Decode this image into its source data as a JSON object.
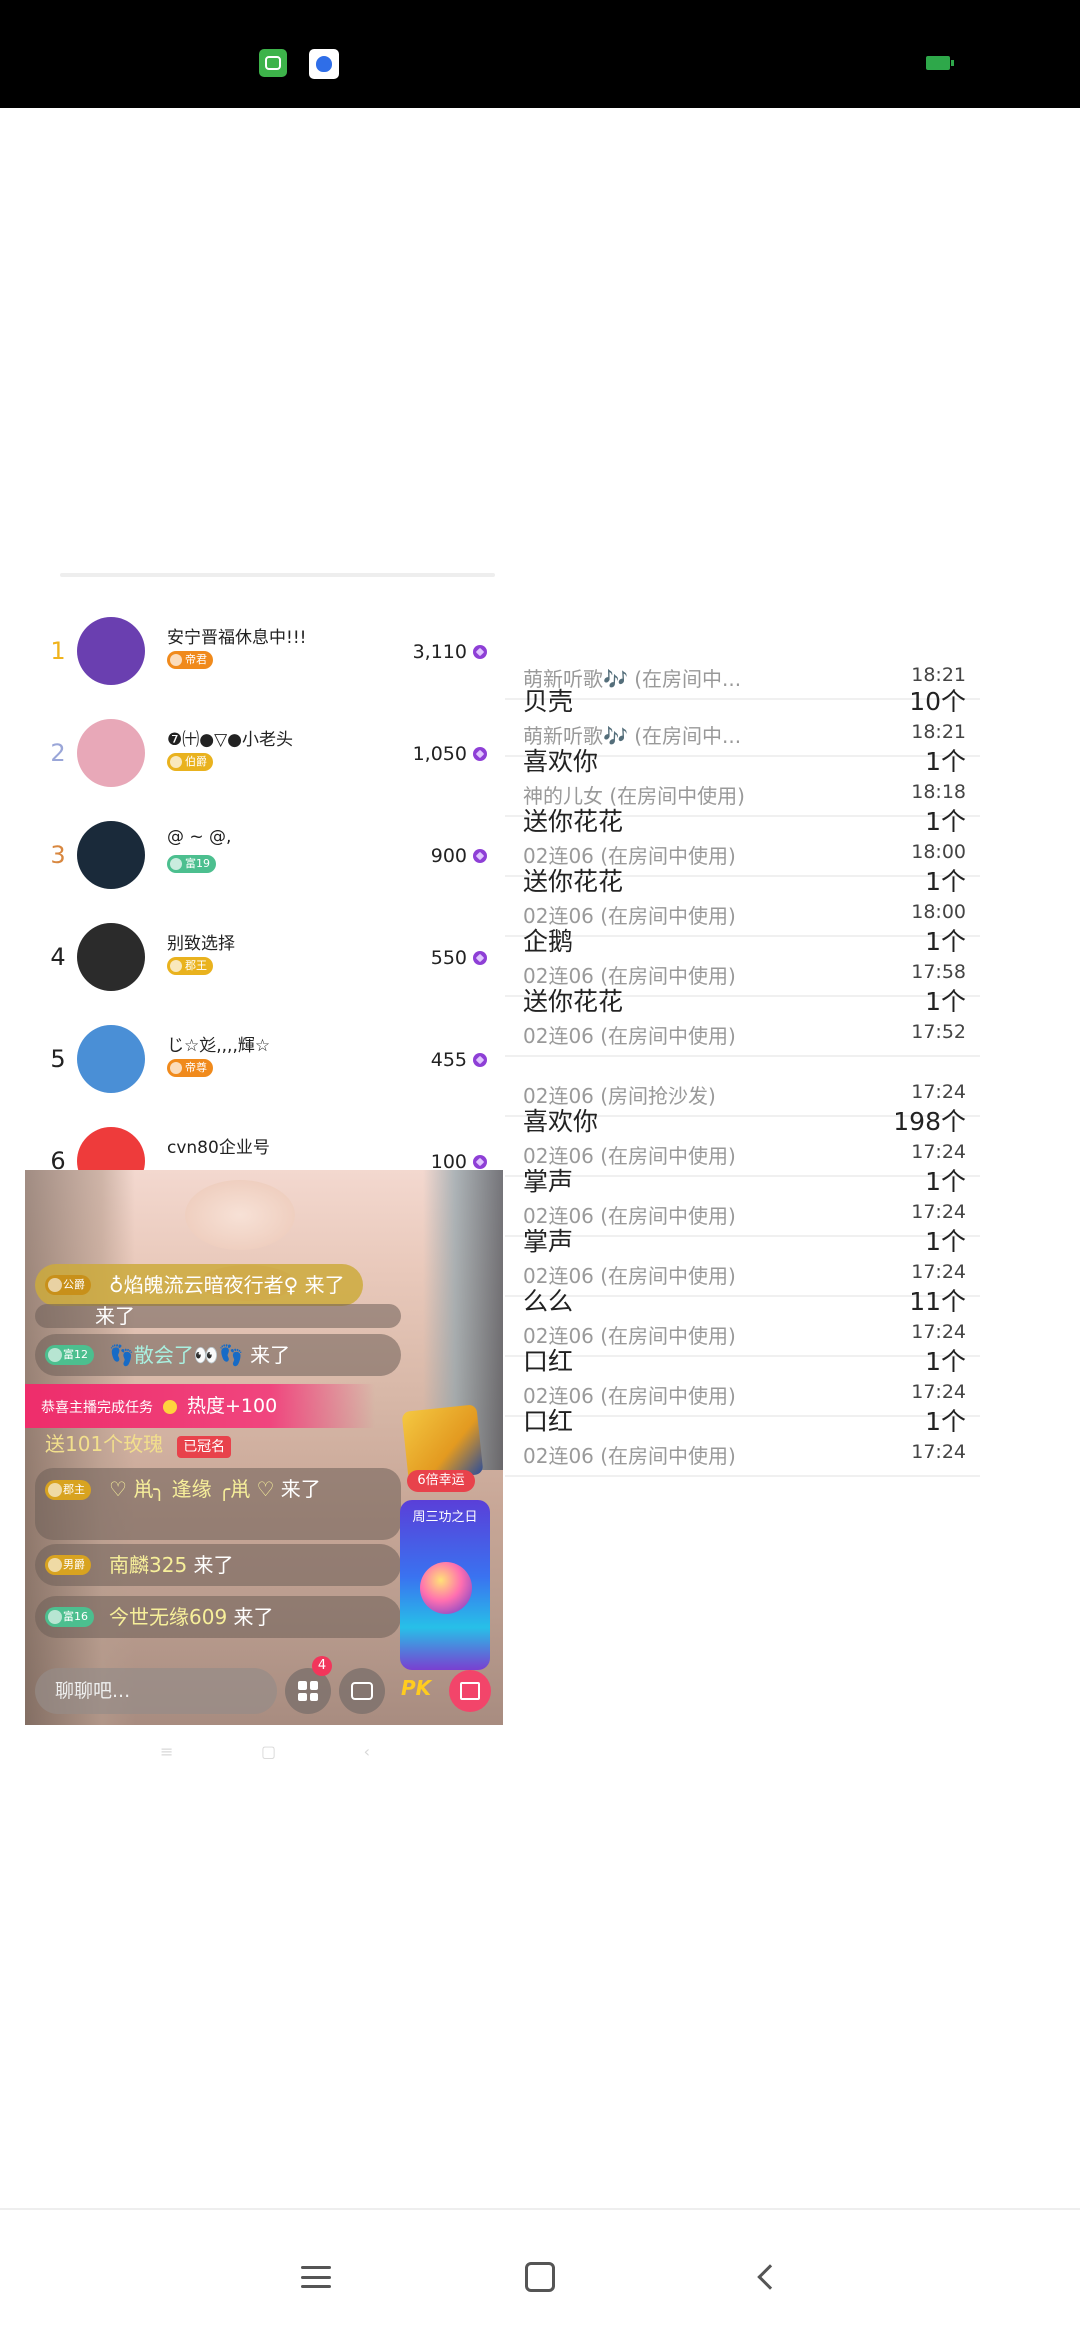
{
  "ranking": [
    {
      "rank": "1",
      "name": "安宁晋福休息中!!!",
      "badge": "帝君",
      "badge_color": "#f08a1c",
      "value": "3,110",
      "rank_color": "#f0b31c",
      "avatar_color": "#6a3fb0"
    },
    {
      "rank": "2",
      "name": "❼㈩●▽●小老头",
      "badge": "伯爵",
      "badge_color": "#e9b21e",
      "value": "1,050",
      "rank_color": "#9aa6d8",
      "avatar_color": "#e8a8b8"
    },
    {
      "rank": "3",
      "name": "@ ~ @,",
      "badge": "富19",
      "badge_color": "#4cbf8f",
      "value": "900",
      "rank_color": "#d8873f",
      "avatar_color": "#1a2a3a"
    },
    {
      "rank": "4",
      "name": "别致选择",
      "badge": "郡王",
      "badge_color": "#e9b21e",
      "value": "550",
      "rank_color": "#222222",
      "avatar_color": "#2b2b2b"
    },
    {
      "rank": "5",
      "name": "じ☆彣,,,,輝☆",
      "badge": "帝尊",
      "badge_color": "#f08a1c",
      "value": "455",
      "rank_color": "#222222",
      "avatar_color": "#4a8fd6"
    },
    {
      "rank": "6",
      "name": "cvn80企业号",
      "badge": "",
      "badge_color": "#ffffff",
      "value": "100",
      "rank_color": "#222222",
      "avatar_color": "#ee3b3b"
    }
  ],
  "live": {
    "messages": [
      {
        "level": "公爵",
        "level_color": "#d8a320",
        "user": "♁焰魄流云暗夜行者♀",
        "action": "来了"
      },
      {
        "level": "",
        "level_color": "#999999",
        "user": "",
        "action": "来了"
      },
      {
        "level": "富12",
        "level_color": "#4cbf8f",
        "user": "👣散会了👀👣",
        "action": "来了"
      },
      {
        "level": "郡主",
        "level_color": "#d8a320",
        "user": "♡ 鼡╮ 逢缘 ╭鼡 ♡",
        "action": "来了"
      },
      {
        "level": "男爵",
        "level_color": "#d8a320",
        "user": "南麟325",
        "action": "来了"
      },
      {
        "level": "富16",
        "level_color": "#4cbf8f",
        "user": "今世无缘609",
        "action": "来了"
      }
    ],
    "task_banner": "恭喜主播完成任务",
    "task_heat": "热度+100",
    "rose_line": "送101个玫瑰",
    "crown_label": "已冠名",
    "lucky_label": "6倍幸运",
    "promo_title": "周三功之日",
    "chat_placeholder": "聊聊吧...",
    "notif_count": "4",
    "pk_label": "PK"
  },
  "gifts": [
    {
      "name": "",
      "count": "",
      "sub": "萌新听歌🎶 (在房间中...",
      "time": "18:21"
    },
    {
      "name": "贝壳",
      "count": "10个",
      "sub": "萌新听歌🎶 (在房间中...",
      "time": "18:21"
    },
    {
      "name": "喜欢你",
      "count": "1个",
      "sub": "神的儿女 (在房间中使用)",
      "time": "18:18"
    },
    {
      "name": "送你花花",
      "count": "1个",
      "sub": "02连06 (在房间中使用)",
      "time": "18:00"
    },
    {
      "name": "送你花花",
      "count": "1个",
      "sub": "02连06 (在房间中使用)",
      "time": "18:00"
    },
    {
      "name": "企鹅",
      "count": "1个",
      "sub": "02连06 (在房间中使用)",
      "time": "17:58"
    },
    {
      "name": "送你花花",
      "count": "1个",
      "sub": "02连06 (在房间中使用)",
      "time": "17:52"
    },
    {
      "name": "",
      "count": "",
      "sub": "02连06 (房间抢沙发)",
      "time": "17:24"
    },
    {
      "name": "喜欢你",
      "count": "198个",
      "sub": "02连06 (在房间中使用)",
      "time": "17:24"
    },
    {
      "name": "掌声",
      "count": "1个",
      "sub": "02连06 (在房间中使用)",
      "time": "17:24"
    },
    {
      "name": "掌声",
      "count": "1个",
      "sub": "02连06 (在房间中使用)",
      "time": "17:24"
    },
    {
      "name": "么么",
      "count": "11个",
      "sub": "02连06 (在房间中使用)",
      "time": "17:24"
    },
    {
      "name": "口红",
      "count": "1个",
      "sub": "02连06 (在房间中使用)",
      "time": "17:24"
    },
    {
      "name": "口红",
      "count": "1个",
      "sub": "02连06 (在房间中使用)",
      "time": "17:24"
    }
  ],
  "icons": {
    "status_app1": "android-app-icon",
    "status_app2": "baidu-paw-icon",
    "battery": "battery-icon",
    "currency": "gem-icon",
    "nav_menu": "menu-icon",
    "nav_home": "home-icon",
    "nav_back": "back-icon"
  }
}
